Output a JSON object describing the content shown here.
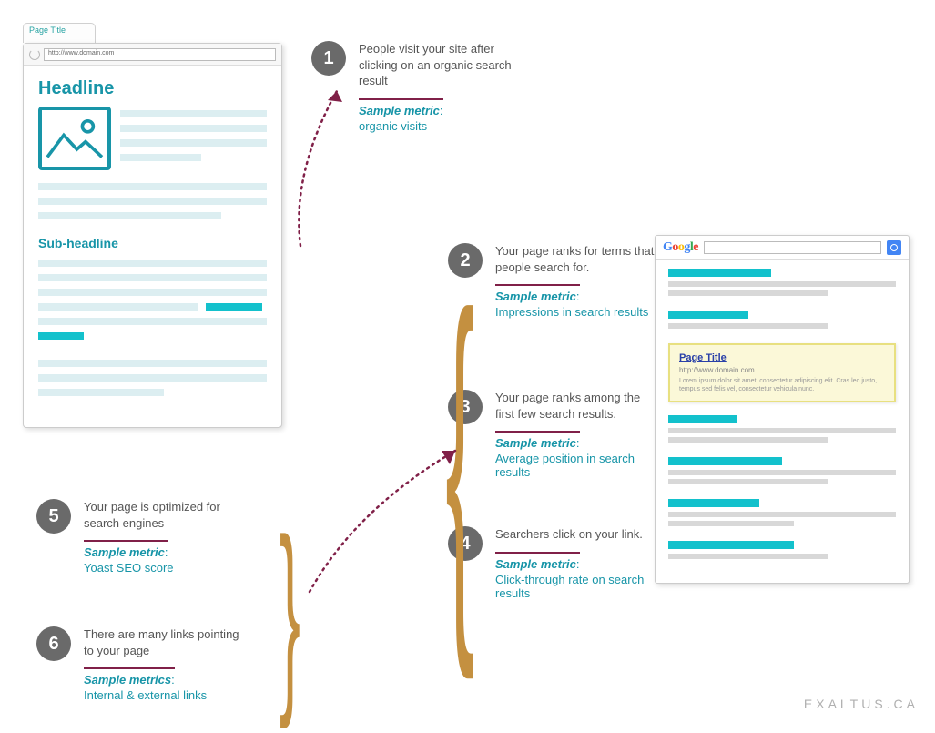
{
  "page_mock": {
    "tab_label": "Page Title",
    "url": "http://www.domain.com",
    "headline": "Headline",
    "sub_headline": "Sub-headline"
  },
  "steps": [
    {
      "num": "1",
      "desc": "People visit your site after clicking on an organic search result",
      "metric_label": "Sample metric",
      "metric_value": "organic visits"
    },
    {
      "num": "2",
      "desc": "Your page ranks for terms that people search for.",
      "metric_label": "Sample metric",
      "metric_value": "Impressions in search results"
    },
    {
      "num": "3",
      "desc": "Your page ranks among the first few search results.",
      "metric_label": "Sample metric",
      "metric_value": "Average position in search results"
    },
    {
      "num": "4",
      "desc": "Searchers click on your link.",
      "metric_label": "Sample metric",
      "metric_value": "Click-through rate on search results"
    },
    {
      "num": "5",
      "desc": "Your page is optimized for search engines",
      "metric_label": "Sample metric",
      "metric_value": "Yoast SEO score"
    },
    {
      "num": "6",
      "desc": "There are many links pointing to your page",
      "metric_label": "Sample metrics",
      "metric_value": "Internal & external links"
    }
  ],
  "google_mock": {
    "logo": "Google",
    "highlighted": {
      "title": "Page Title",
      "url": "http://www.domain.com",
      "desc": "Lorem ipsum dolor sit amet, consectetur adipiscing elit. Cras leo justo, tempus sed felis vel, consectetur vehicula nunc."
    }
  },
  "footer": "EXALTUS.CA"
}
